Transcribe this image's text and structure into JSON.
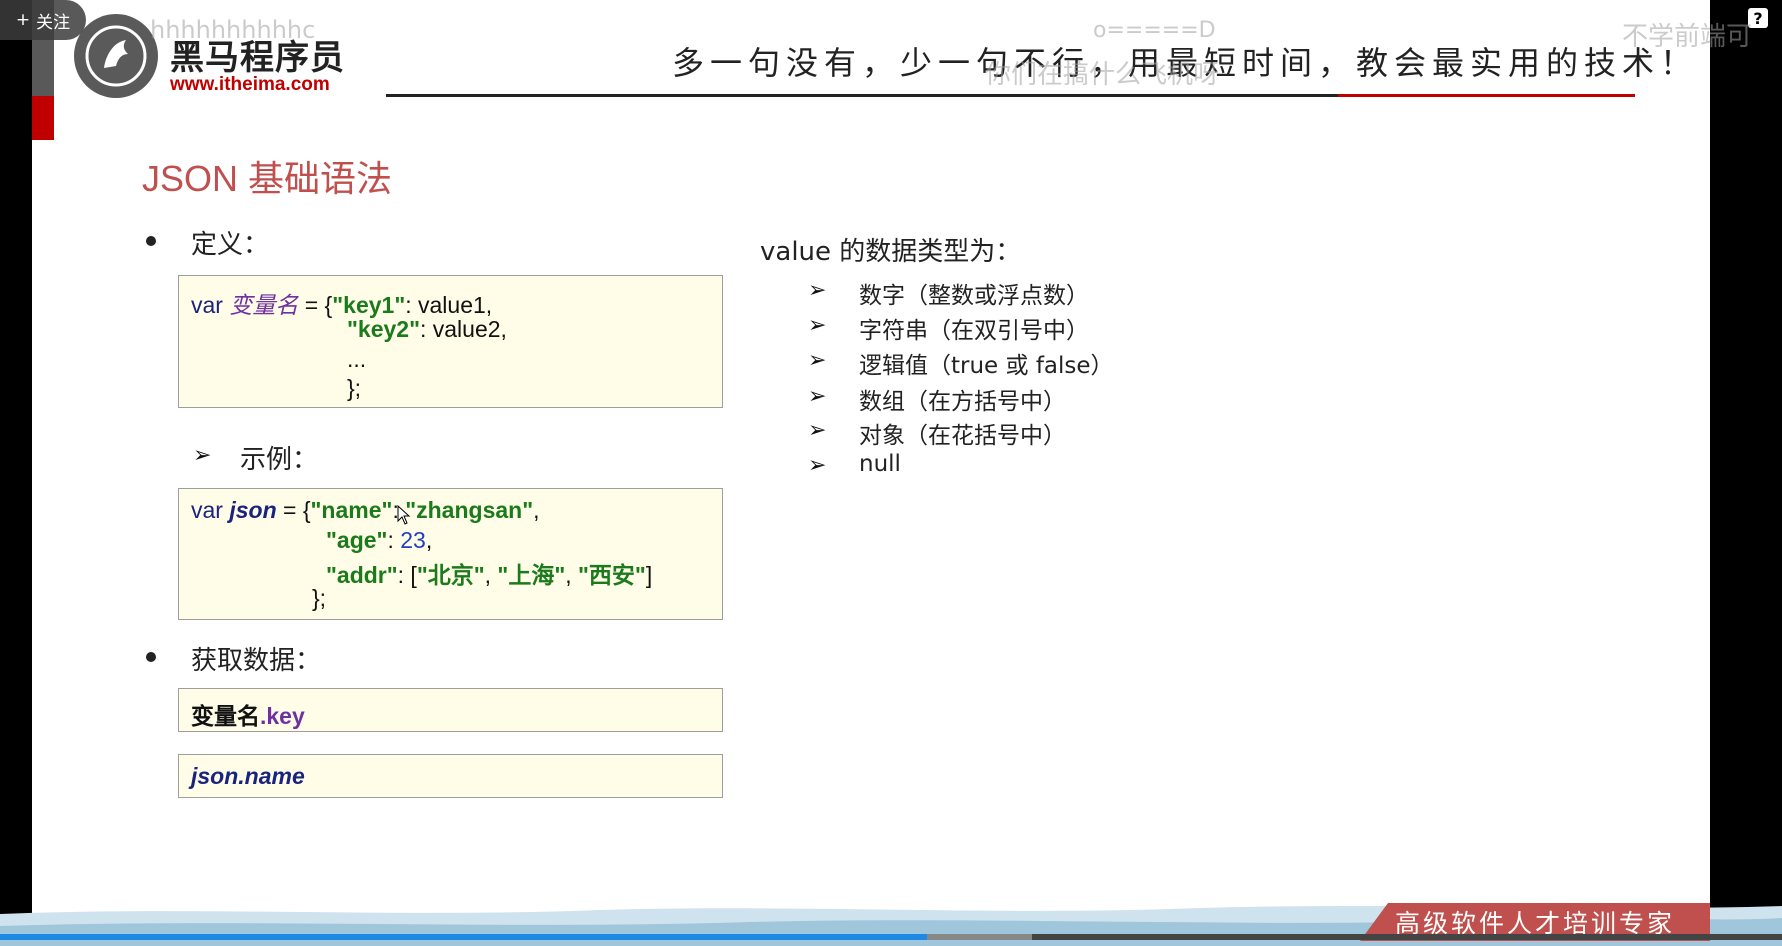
{
  "header": {
    "logo_title": "黑马程序员",
    "logo_url": "www.itheima.com",
    "slogan": "多一句没有，少一句不行，用最短时间，教会最实用的技术！"
  },
  "slide": {
    "title": "JSON 基础语法",
    "definition": {
      "label": "定义：",
      "code": {
        "kw": "var",
        "var_name": "变量名",
        "assign": " = {",
        "key1": "\"key1\"",
        "val1": ": value1,",
        "key2": "\"key2\"",
        "val2": ": value2,",
        "ellipsis": "...",
        "close": "};"
      }
    },
    "example": {
      "label": "示例：",
      "code": {
        "kw": "var",
        "var_name": "json",
        "assign": " = {",
        "k_name": "\"name\"",
        "colon1": ": ",
        "v_name": "\"zhangsan\"",
        "comma1": ",",
        "k_age": "\"age\"",
        "colon2": ": ",
        "v_age": "23",
        "comma2": ",",
        "k_addr": "\"addr\"",
        "colon3": ": [",
        "v_addr1": "\"北京\"",
        "sep1": ", ",
        "v_addr2": "\"上海\"",
        "sep2": ", ",
        "v_addr3": "\"西安\"",
        "bracket": "]",
        "close": "};"
      }
    },
    "get_data": {
      "label": "获取数据：",
      "syntax_bold": "变量名",
      "syntax_key": ".key",
      "example": "json.name"
    },
    "value_types": {
      "heading": "value 的数据类型为：",
      "items": [
        "数字（整数或浮点数）",
        "字符串（在双引号中）",
        "逻辑值（true 或 false）",
        "数组（在方括号中）",
        "对象（在花括号中）",
        "null"
      ]
    }
  },
  "footer": {
    "tagline": "高级软件人才培训专家"
  },
  "player": {
    "follow_label": "关注",
    "follow_icon": "plus-icon",
    "help_label": "?",
    "progress_fraction": 0.52
  },
  "danmaku": [
    "不学前端可",
    "hhhhhhhhhhc",
    "你们在搞什么飞机呀",
    "o=====D"
  ]
}
